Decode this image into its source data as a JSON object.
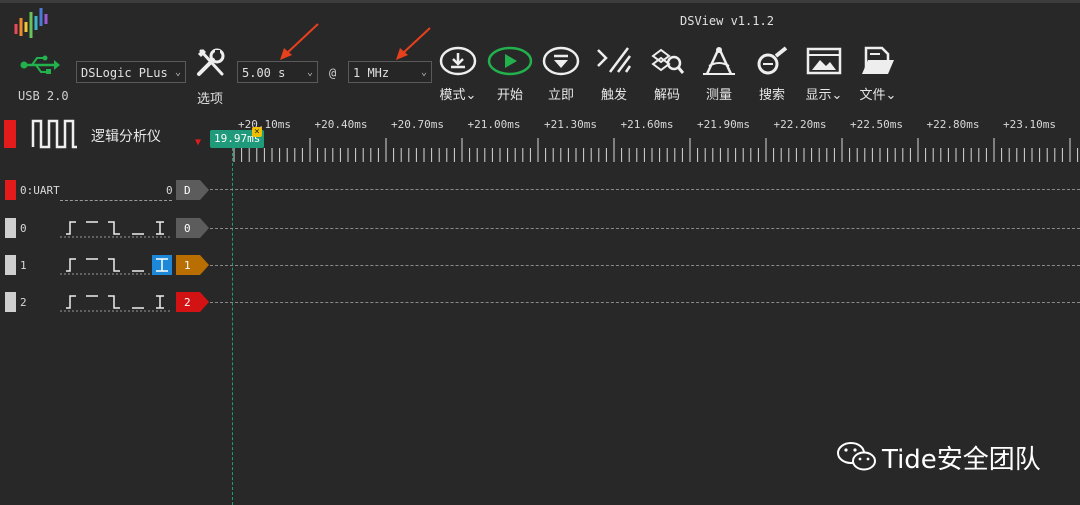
{
  "window": {
    "title": "DSView v1.1.2"
  },
  "toolbar": {
    "usb_label": "USB 2.0",
    "device": {
      "selected": "DSLogic PLus"
    },
    "duration": {
      "selected": "5.00 s"
    },
    "at_sign": "@",
    "samplerate": {
      "selected": "1 MHz"
    },
    "options_label": "选项",
    "buttons": [
      {
        "label": "模式",
        "icon": "download-icon"
      },
      {
        "label": "开始",
        "icon": "play-icon"
      },
      {
        "label": "立即",
        "icon": "instant-icon"
      },
      {
        "label": "触发",
        "icon": "trigger-icon"
      },
      {
        "label": "解码",
        "icon": "decode-icon"
      },
      {
        "label": "测量",
        "icon": "measure-icon"
      },
      {
        "label": "搜索",
        "icon": "search-icon"
      },
      {
        "label": "显示",
        "icon": "display-icon"
      },
      {
        "label": "文件",
        "icon": "file-icon"
      }
    ],
    "accent_green": "#22b14c",
    "arrow_color": "#e8401c"
  },
  "analyzer": {
    "label": "逻辑分析仪"
  },
  "ruler": {
    "ticks": [
      "+20.10ms",
      "+20.40ms",
      "+20.70ms",
      "+21.00ms",
      "+21.30ms",
      "+21.60ms",
      "+21.90ms",
      "+22.20ms",
      "+22.50ms",
      "+22.80ms",
      "+23.10ms"
    ],
    "cursor_label": "19.97ms",
    "cursor_close": "×"
  },
  "channels": [
    {
      "name": "0:UART",
      "value": "0",
      "tag": "D",
      "tag_color": "#5c5c5c",
      "marker_color": "#e31b1b"
    },
    {
      "name": "0",
      "tag": "0",
      "tag_color": "#5c5c5c",
      "marker_color": "#cfcfcf"
    },
    {
      "name": "1",
      "tag": "1",
      "tag_color": "#b86e00",
      "marker_color": "#cfcfcf"
    },
    {
      "name": "2",
      "tag": "2",
      "tag_color": "#d31313",
      "marker_color": "#cfcfcf"
    }
  ],
  "watermark": {
    "text": "Tide安全团队"
  }
}
